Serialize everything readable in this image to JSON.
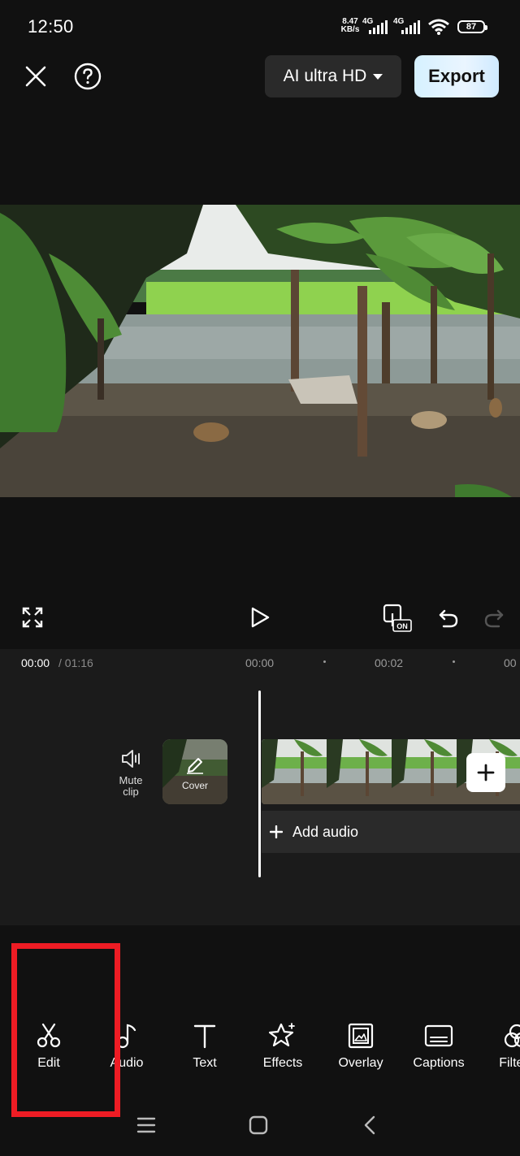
{
  "status_bar": {
    "time": "12:50",
    "net_rate_value": "8.47",
    "net_rate_unit": "KB/s",
    "sim1": "4G",
    "sim2": "4G",
    "battery": "87"
  },
  "header": {
    "quality_label": "AI ultra HD",
    "export_label": "Export"
  },
  "timeline": {
    "current_time": "00:00",
    "total_time": "/ 01:16",
    "ticks": [
      "00:00",
      "00:02",
      "00"
    ],
    "mute_label_line1": "Mute",
    "mute_label_line2": "clip",
    "cover_label": "Cover",
    "add_audio_label": "Add audio"
  },
  "toolbar": {
    "tools": [
      {
        "label": "Edit",
        "icon": "scissors-icon"
      },
      {
        "label": "Audio",
        "icon": "music-note-icon"
      },
      {
        "label": "Text",
        "icon": "text-icon"
      },
      {
        "label": "Effects",
        "icon": "sparkle-star-icon"
      },
      {
        "label": "Overlay",
        "icon": "overlay-icon"
      },
      {
        "label": "Captions",
        "icon": "captions-icon"
      },
      {
        "label": "Filters",
        "icon": "filters-icon"
      }
    ],
    "highlight_color": "#ee1c24"
  },
  "colors": {
    "background": "#111111",
    "panel": "#1b1b1b",
    "accent_export": "#d6f1ff"
  }
}
